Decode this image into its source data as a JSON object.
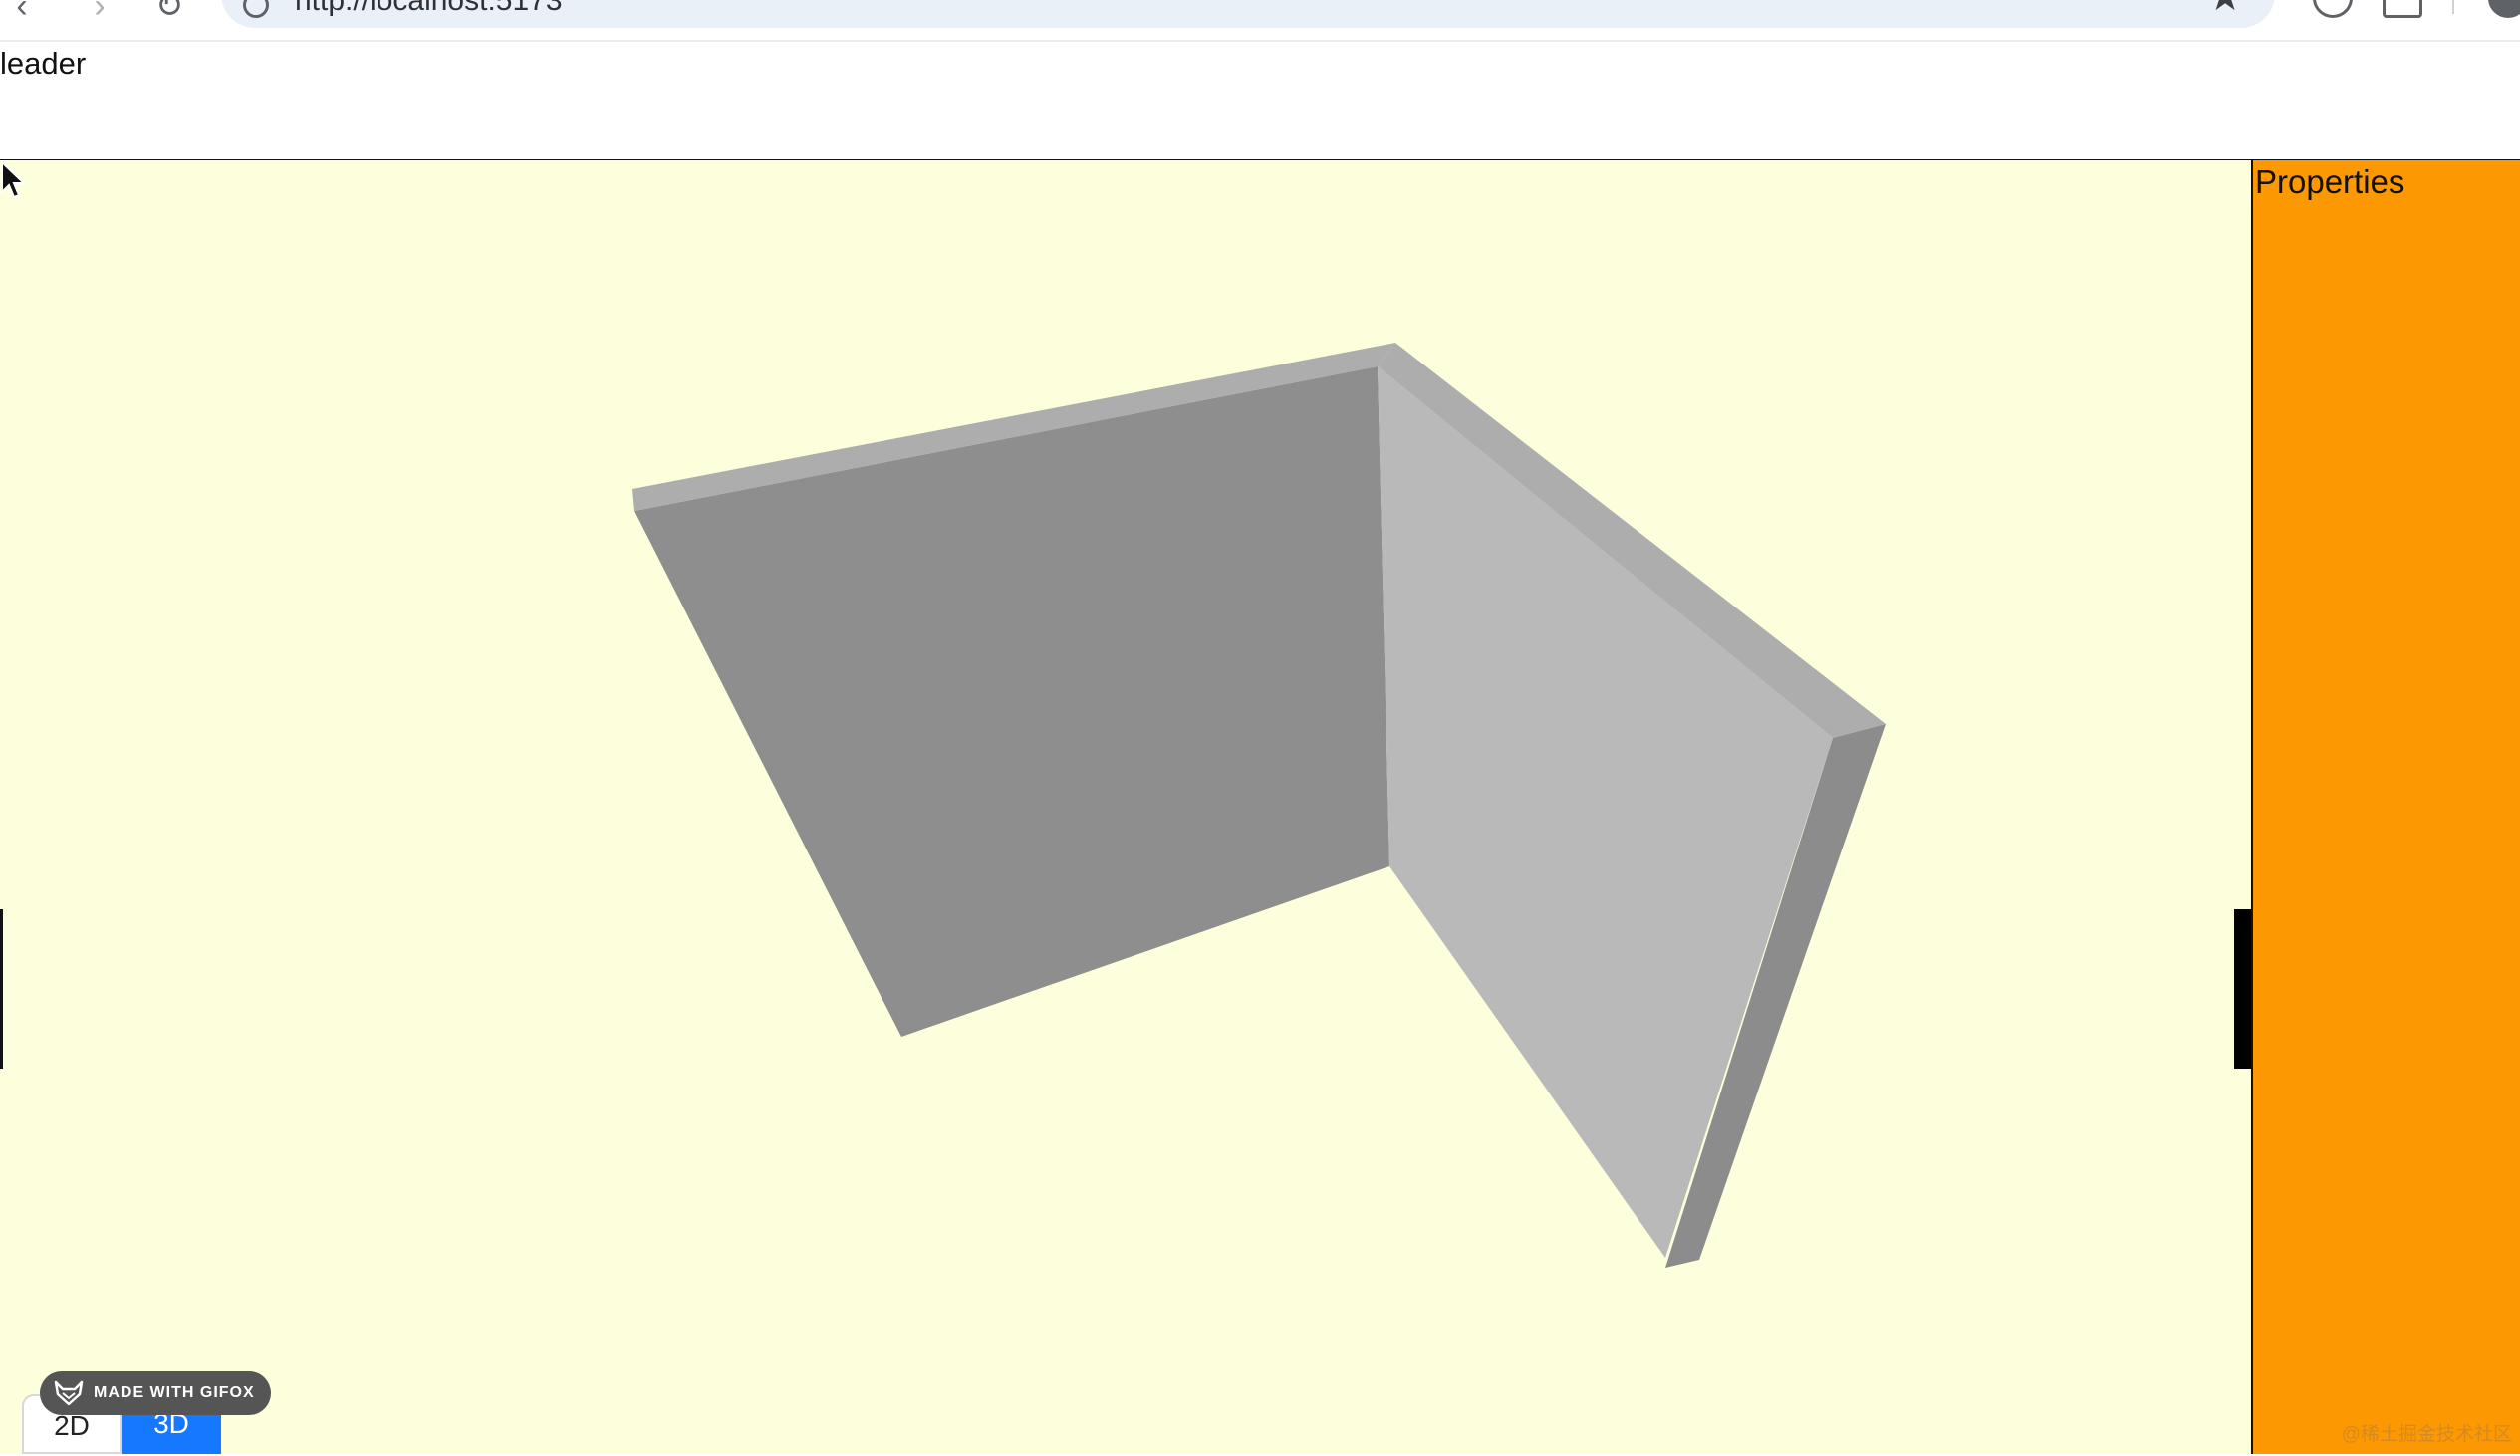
{
  "browser": {
    "url": "http://localhost:5173",
    "back_icon": "back-arrow-icon",
    "forward_icon": "forward-arrow-icon",
    "reload_icon": "reload-icon",
    "bookmark_icon": "star-icon"
  },
  "header": {
    "title": "leader"
  },
  "viewport": {
    "background": "#fdfedb",
    "wall_colors": {
      "back_face": "#8e8e8e",
      "top_edge": "#adadad",
      "side_face": "#b9b9b9",
      "end_face": "#8c8c8c"
    }
  },
  "properties_panel": {
    "title": "Properties",
    "background": "#fc9802"
  },
  "view_toggle": {
    "options": [
      "2D",
      "3D"
    ],
    "active": "3D",
    "active_color": "#1677ff"
  },
  "gifox_badge": {
    "label": "MADE WITH GIFOX"
  },
  "watermark": {
    "text": "@稀土掘金技术社区"
  }
}
